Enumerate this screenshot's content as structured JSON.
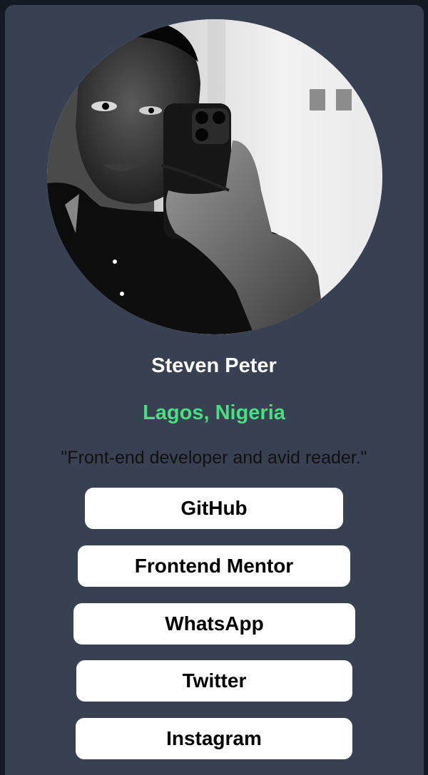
{
  "profile": {
    "name": "Steven Peter",
    "location": "Lagos, Nigeria",
    "bio": "\"Front-end developer and avid reader.\""
  },
  "links": [
    {
      "label": "GitHub"
    },
    {
      "label": "Frontend Mentor"
    },
    {
      "label": "WhatsApp"
    },
    {
      "label": "Twitter"
    },
    {
      "label": "Instagram"
    }
  ],
  "colors": {
    "page_background": "#141a24",
    "card_background": "#374151",
    "accent_green": "#4ade80",
    "button_background": "#ffffff"
  }
}
